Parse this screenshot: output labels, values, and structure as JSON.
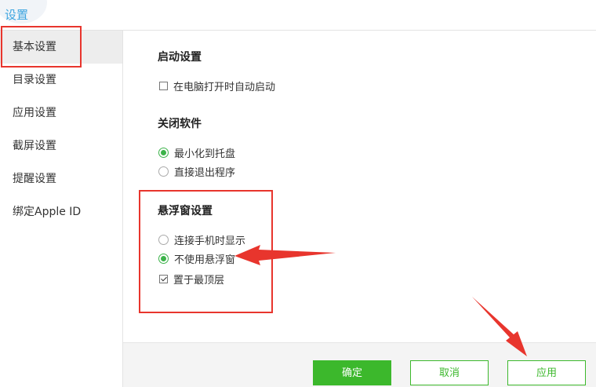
{
  "window": {
    "title": "设置"
  },
  "sidebar": {
    "items": [
      {
        "label": "基本设置",
        "active": true
      },
      {
        "label": "目录设置"
      },
      {
        "label": "应用设置"
      },
      {
        "label": "截屏设置"
      },
      {
        "label": "提醒设置"
      },
      {
        "label": "绑定Apple ID"
      }
    ]
  },
  "sections": {
    "startup": {
      "title": "启动设置",
      "auto_start": {
        "label": "在电脑打开时自动启动",
        "checked": false
      }
    },
    "close": {
      "title": "关闭软件",
      "minimize_tray": {
        "label": "最小化到托盘",
        "selected": true
      },
      "exit_program": {
        "label": "直接退出程序",
        "selected": false
      }
    },
    "floating": {
      "title": "悬浮窗设置",
      "show_on_connect": {
        "label": "连接手机时显示",
        "selected": false
      },
      "no_floating": {
        "label": "不使用悬浮窗",
        "selected": true
      },
      "always_on_top": {
        "label": "置于最顶层",
        "checked": true
      }
    }
  },
  "footer": {
    "ok_label": "确定",
    "cancel_label": "取消",
    "apply_label": "应用"
  },
  "colors": {
    "accent": "#3cb82c",
    "title": "#3da5e0",
    "annotation": "#e8352d"
  }
}
